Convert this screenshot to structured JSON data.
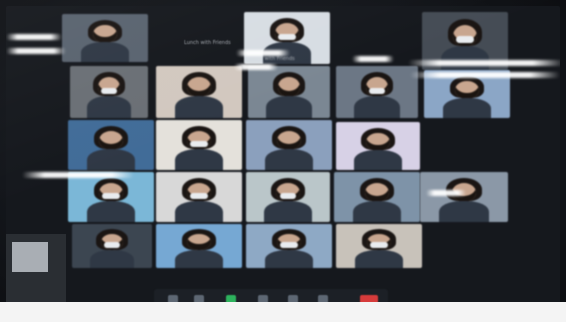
{
  "scene": {
    "kind": "photo-of-video-call-screen",
    "screen_title": "Lunch with Friends"
  },
  "tiles": [
    {
      "label": "",
      "bg": "#596370"
    },
    {
      "label": "Lunch with Friends",
      "bg": "#d7dde3"
    },
    {
      "label": "",
      "bg": "#454c55"
    },
    {
      "label": "",
      "bg": "#6a6f75"
    },
    {
      "label": "",
      "bg": "#d2c8be"
    },
    {
      "label": "",
      "bg": "#7a8794"
    },
    {
      "label": "",
      "bg": "#6c7786"
    },
    {
      "label": "",
      "bg": "#8aa6c8"
    },
    {
      "label": "",
      "bg": "#3f6c9b"
    },
    {
      "label": "",
      "bg": "#e4e1db"
    },
    {
      "label": "",
      "bg": "#8aa0bf"
    },
    {
      "label": "",
      "bg": "#d7d1e7"
    },
    {
      "label": "",
      "bg": "#78b8d9"
    },
    {
      "label": "",
      "bg": "#d8d8d8"
    },
    {
      "label": "",
      "bg": "#b9c6c9"
    },
    {
      "label": "",
      "bg": "#7d93a9"
    },
    {
      "label": "",
      "bg": "#8a98a8"
    },
    {
      "label": "",
      "bg": "#3c4652"
    },
    {
      "label": "",
      "bg": "#74a8d6"
    },
    {
      "label": "",
      "bg": "#8da9c7"
    },
    {
      "label": "",
      "bg": "#c8c2ba"
    }
  ]
}
